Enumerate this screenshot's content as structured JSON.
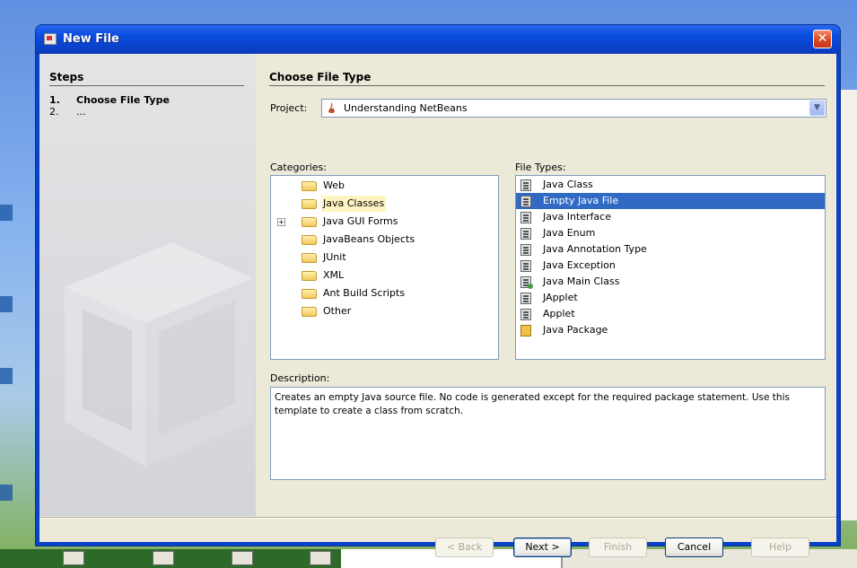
{
  "window": {
    "title": "New File",
    "close_glyph": "✕"
  },
  "steps": {
    "heading": "Steps",
    "items": [
      {
        "num": "1.",
        "label": "Choose File Type"
      },
      {
        "num": "2.",
        "label": "..."
      }
    ]
  },
  "panel": {
    "title": "Choose File Type",
    "project_label": "Project:",
    "project_value": "Understanding NetBeans",
    "categories_label": "Categories:",
    "file_types_label": "File Types:",
    "categories": [
      {
        "label": "Web",
        "expandable": false,
        "selected": false
      },
      {
        "label": "Java Classes",
        "expandable": false,
        "selected": true
      },
      {
        "label": "Java GUI Forms",
        "expandable": true,
        "selected": false
      },
      {
        "label": "JavaBeans Objects",
        "expandable": false,
        "selected": false
      },
      {
        "label": "JUnit",
        "expandable": false,
        "selected": false
      },
      {
        "label": "XML",
        "expandable": false,
        "selected": false
      },
      {
        "label": "Ant Build Scripts",
        "expandable": false,
        "selected": false
      },
      {
        "label": "Other",
        "expandable": false,
        "selected": false
      }
    ],
    "file_types": [
      {
        "label": "Java Class",
        "icon": "java-class-icon",
        "selected": false
      },
      {
        "label": "Empty Java File",
        "icon": "java-file-icon",
        "selected": true
      },
      {
        "label": "Java Interface",
        "icon": "java-interface-icon",
        "selected": false
      },
      {
        "label": "Java Enum",
        "icon": "java-enum-icon",
        "selected": false
      },
      {
        "label": "Java Annotation Type",
        "icon": "java-annotation-icon",
        "selected": false
      },
      {
        "label": "Java Exception",
        "icon": "java-exception-icon",
        "selected": false
      },
      {
        "label": "Java Main Class",
        "icon": "java-main-class-icon",
        "selected": false
      },
      {
        "label": "JApplet",
        "icon": "japplet-icon",
        "selected": false
      },
      {
        "label": "Applet",
        "icon": "applet-icon",
        "selected": false
      },
      {
        "label": "Java Package",
        "icon": "java-package-icon",
        "selected": false
      }
    ],
    "description_label": "Description:",
    "description_text": "Creates an empty Java source file. No code is generated except for the required package statement. Use this template to create a class from scratch."
  },
  "buttons": {
    "back": "< Back",
    "next": "Next >",
    "finish": "Finish",
    "cancel": "Cancel",
    "help": "Help"
  },
  "colors": {
    "selection": "#316ac5",
    "titlebar": "#0a4de0",
    "dialog_bg": "#ece9d8"
  }
}
